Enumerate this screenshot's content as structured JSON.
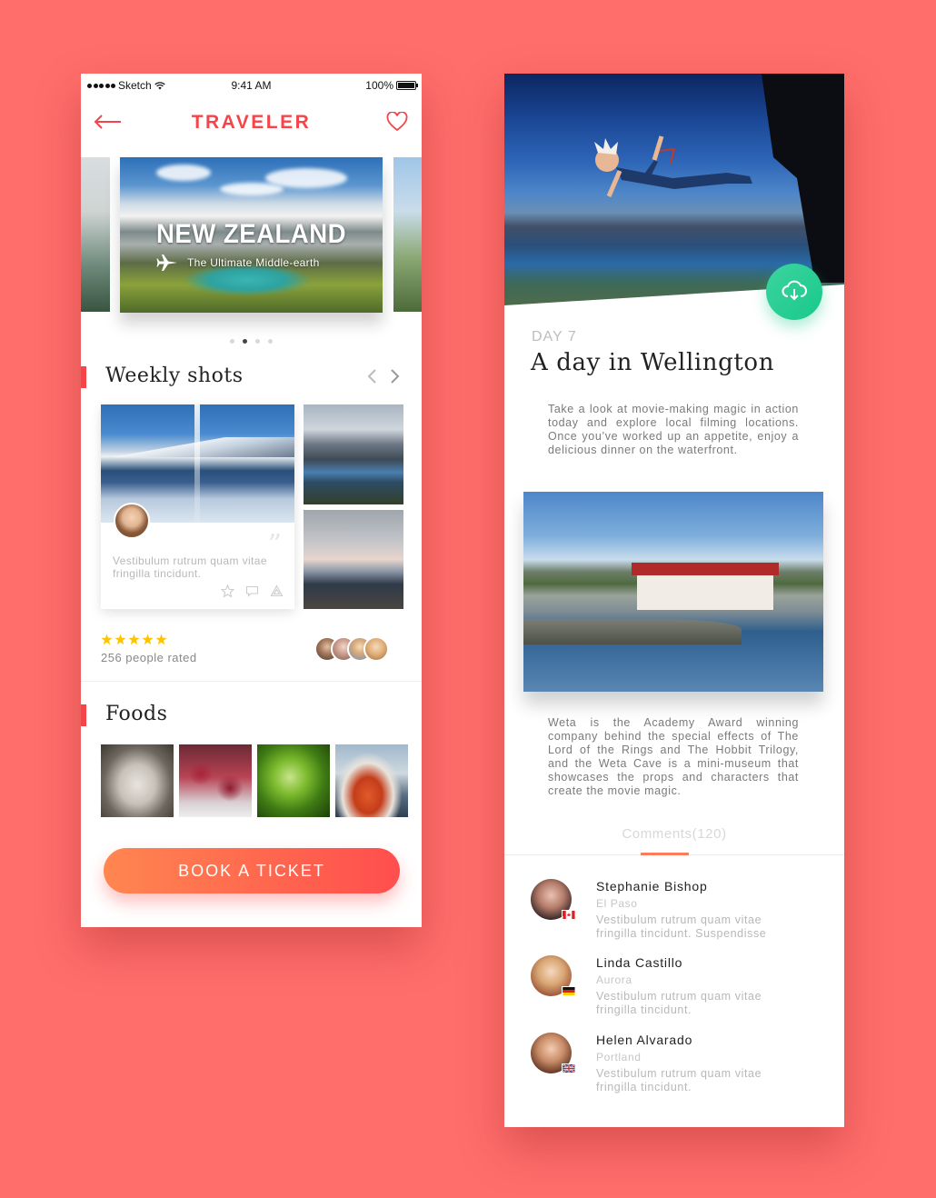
{
  "left": {
    "status": {
      "carrier": "Sketch",
      "time": "9:41 AM",
      "battery": "100%"
    },
    "header": {
      "title": "TRAVELER"
    },
    "carousel": {
      "title": "NEW ZEALAND",
      "subtitle": "The Ultimate Middle-earth",
      "pages": 4,
      "active_page": 2
    },
    "weekly": {
      "title": "Weekly shots",
      "card_text": "Vestibulum rutrum quam vitae fringilla tincidunt."
    },
    "rating": {
      "stars": 5,
      "text": "256 people rated"
    },
    "foods": {
      "title": "Foods"
    },
    "book_button": "BOOK A TICKET"
  },
  "right": {
    "day": "DAY 7",
    "title": "A day in Wellington",
    "para1": "Take a look at movie-making magic in action today and explore local filming locations. Once you’ve worked up an appetite, enjoy a delicious dinner on the waterfront.",
    "para2": "Weta is the Academy Award winning company behind the special effects of The Lord of the Rings and The Hobbit Trilogy, and the Weta Cave is a mini-museum that showcases the props and characters that create the movie magic.",
    "comments_tab": "Comments(120)",
    "comments": [
      {
        "name": "Stephanie Bishop",
        "location": "El Paso",
        "text": "Vestibulum rutrum quam vitae fringilla tincidunt. Suspendisse",
        "flag": "canada"
      },
      {
        "name": "Linda Castillo",
        "location": "Aurora",
        "text": "Vestibulum rutrum quam vitae fringilla tincidunt.",
        "flag": "germany"
      },
      {
        "name": "Helen Alvarado",
        "location": "Portland",
        "text": "Vestibulum rutrum quam vitae fringilla tincidunt.",
        "flag": "uk"
      }
    ]
  },
  "colors": {
    "background": "#FF6E6B",
    "accent": "#F5444A",
    "button_gradient_start": "#FF8650",
    "button_gradient_end": "#FF4E4E",
    "download_button": "#18C98A",
    "star": "#FFC400"
  }
}
